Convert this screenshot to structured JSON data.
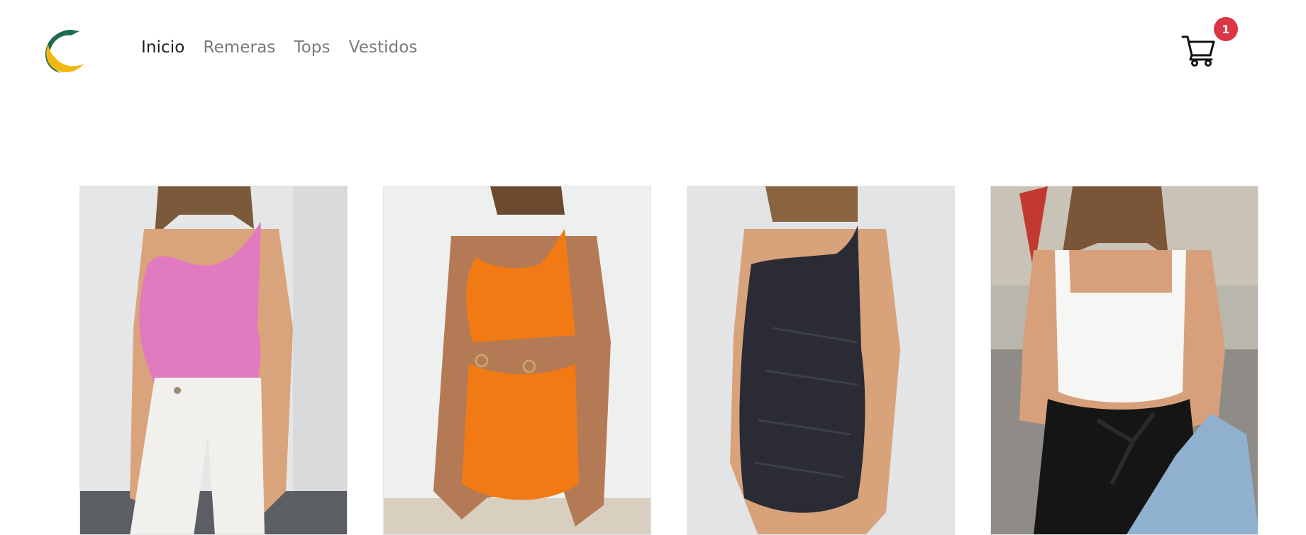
{
  "brand": {
    "logo_name": "crescent-logo",
    "colors": {
      "green": "#1f6b4f",
      "yellow": "#f3b712"
    }
  },
  "nav": {
    "items": [
      {
        "label": "Inicio",
        "active": true
      },
      {
        "label": "Remeras",
        "active": false
      },
      {
        "label": "Tops",
        "active": false
      },
      {
        "label": "Vestidos",
        "active": false
      }
    ]
  },
  "cart": {
    "icon": "shopping-cart-icon",
    "count": "1",
    "badge_color": "#dc3545"
  },
  "products": [
    {
      "image": "pink-ribbed-tank-top",
      "colors": {
        "garment": "#e27ac0",
        "bg": "#e5e6e7"
      }
    },
    {
      "image": "orange-cutout-dress",
      "colors": {
        "garment": "#f27a14",
        "bg": "#eef0ef"
      }
    },
    {
      "image": "black-glitter-dress",
      "colors": {
        "garment": "#2a2b35",
        "bg": "#e2e4e6"
      }
    },
    {
      "image": "white-knit-top",
      "colors": {
        "garment": "#f6f6f5",
        "bg": "#b9b6ad"
      }
    }
  ]
}
